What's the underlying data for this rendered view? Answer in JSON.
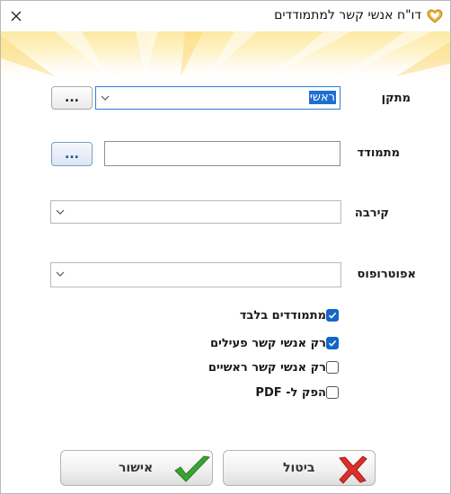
{
  "window": {
    "title": "דו\"ח אנשי קשר למתמודדים"
  },
  "form": {
    "installation": {
      "label": "מתקן",
      "value": "ראשי",
      "browse_label": "..."
    },
    "candidate": {
      "label": "מתמודד",
      "value": "",
      "browse_label": "..."
    },
    "relation": {
      "label": "קירבה",
      "value": ""
    },
    "guardian": {
      "label": "אפוטרופוס",
      "value": ""
    }
  },
  "options": [
    {
      "label": "מתמודדים בלבד",
      "checked": true
    },
    {
      "label": "רק אנשי קשר פעילים",
      "checked": true
    },
    {
      "label": "רק אנשי קשר ראשיים",
      "checked": false
    },
    {
      "label": "הפק ל- PDF",
      "checked": false
    }
  ],
  "buttons": {
    "ok_label": "אישור",
    "cancel_label": "ביטול"
  },
  "icons": {
    "app": "heart-logo-icon",
    "close": "close-icon",
    "dropdown": "chevron-down-icon",
    "ok": "checkmark-icon",
    "cancel": "x-cross-icon"
  },
  "colors": {
    "accent": "#1466c7",
    "banner": "#fde9a3",
    "ok_green": "#3aa335",
    "cancel_red": "#d9302c"
  }
}
